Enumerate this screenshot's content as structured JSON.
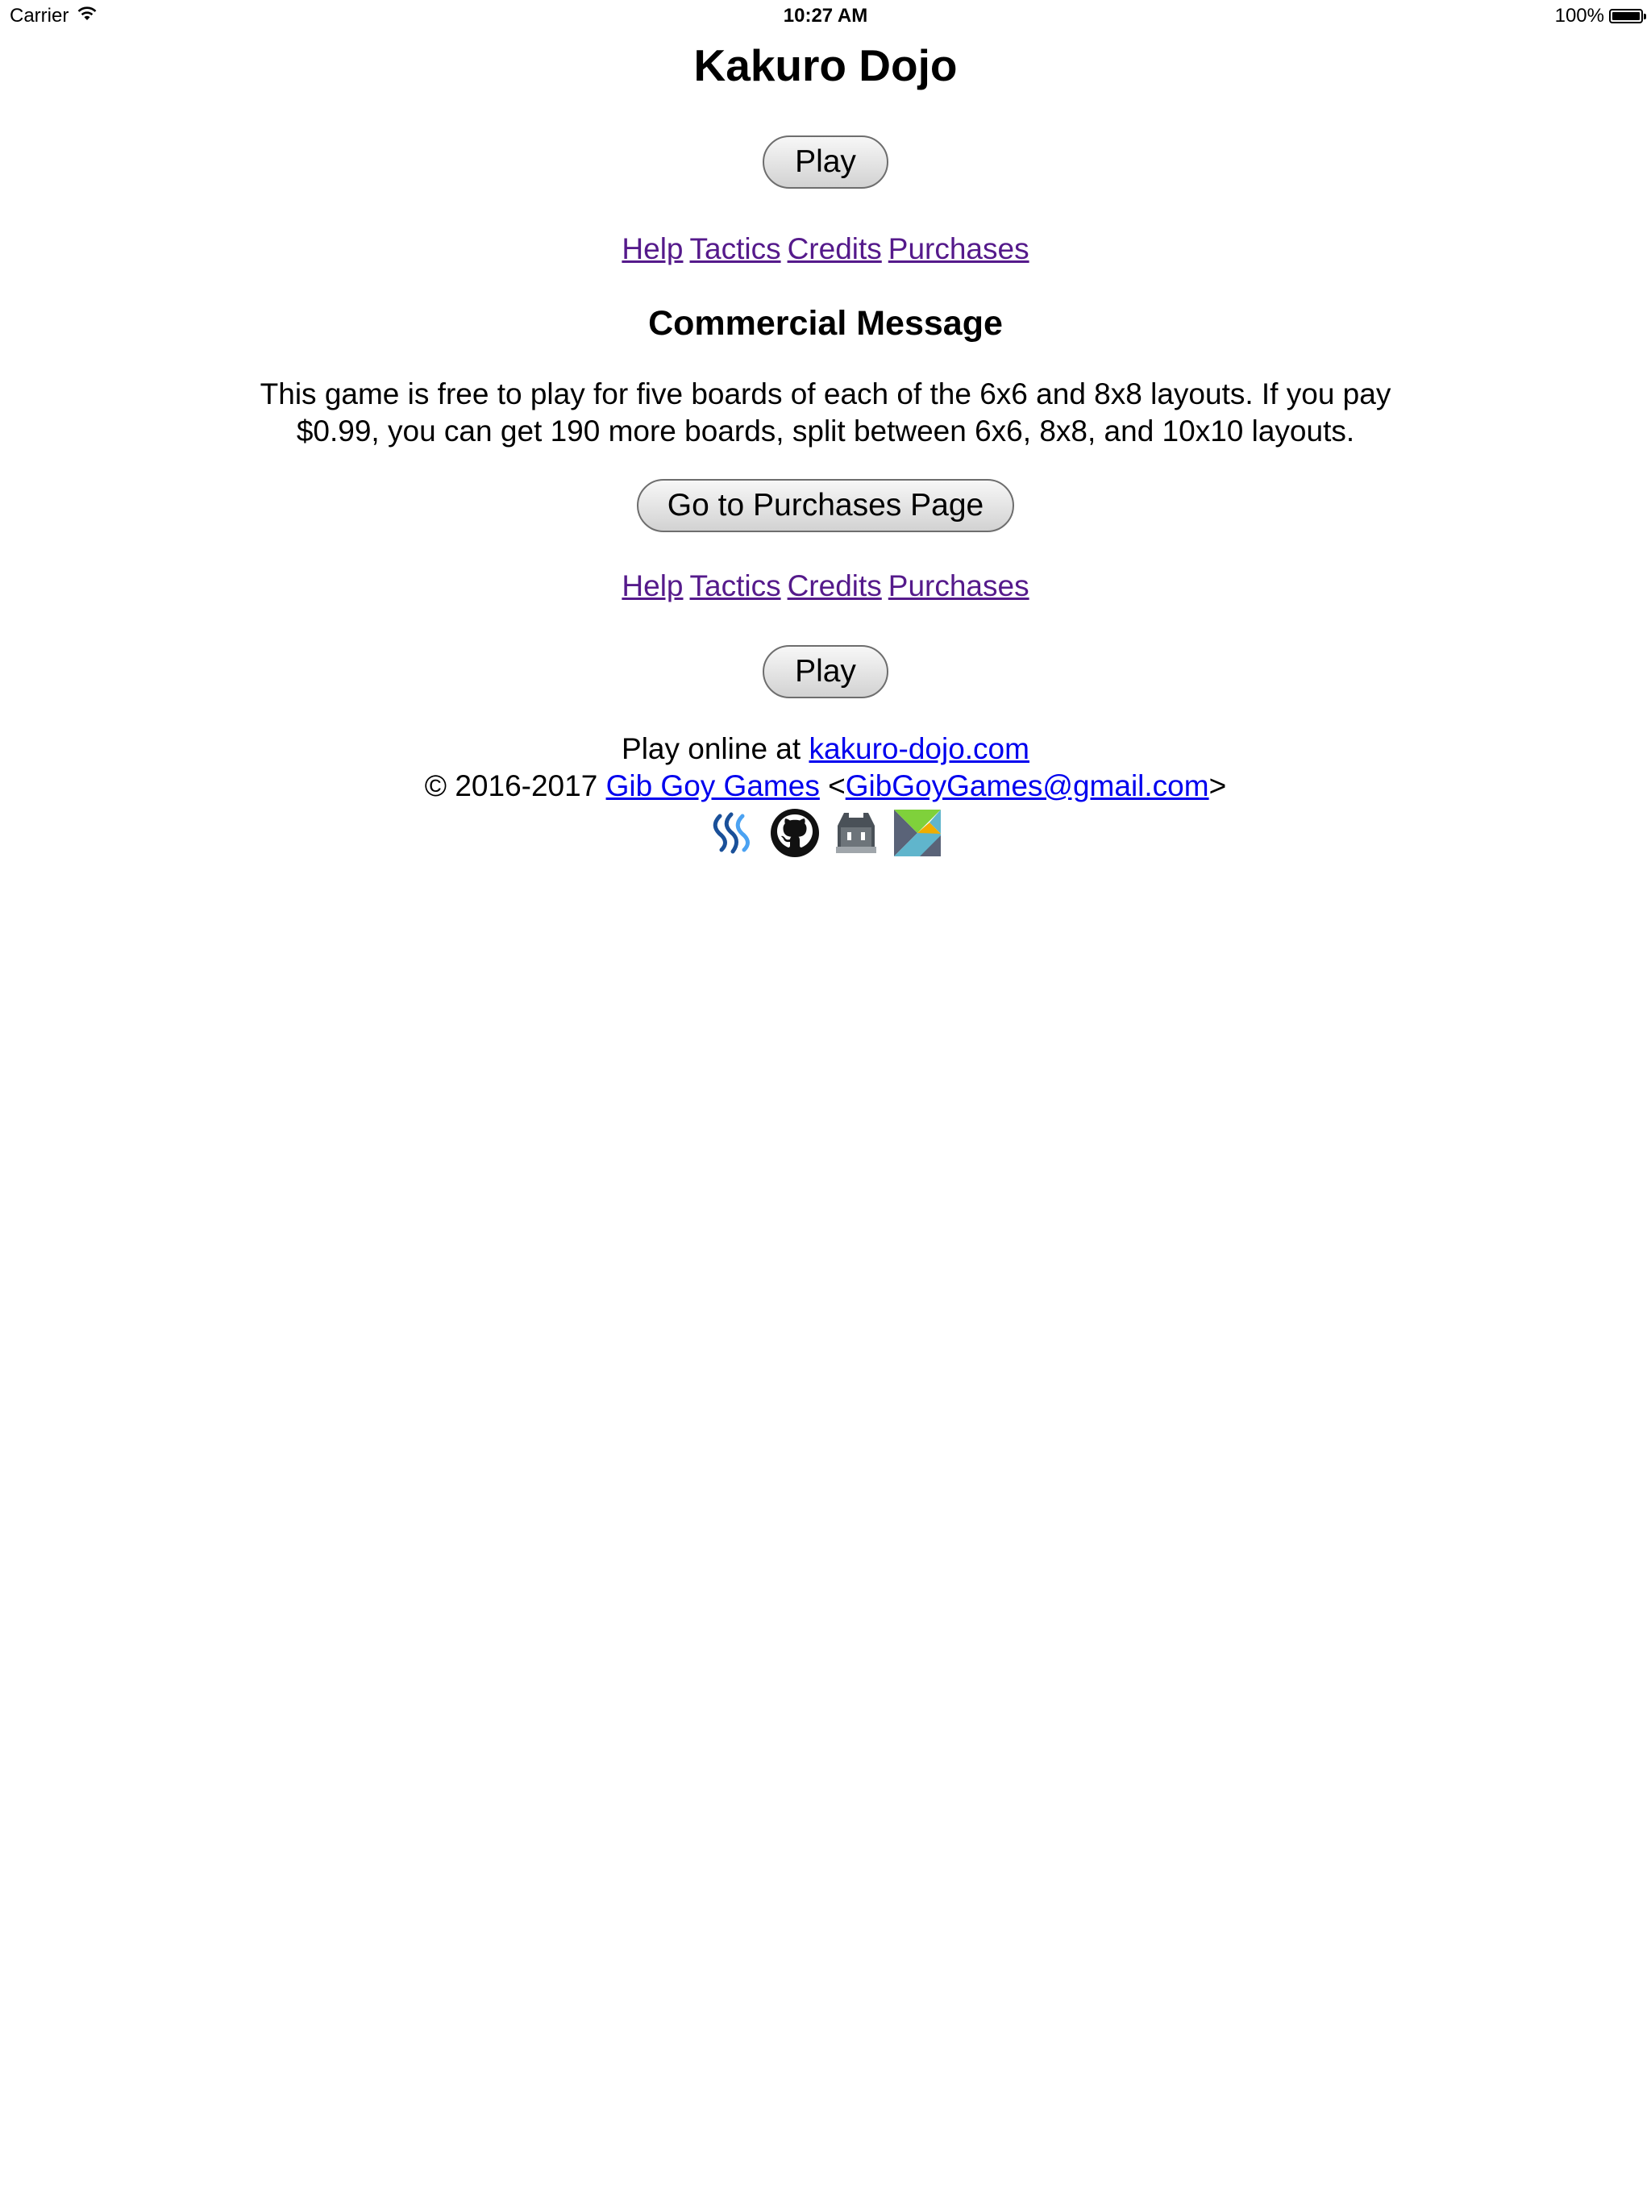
{
  "status_bar": {
    "carrier": "Carrier",
    "time": "10:27 AM",
    "battery_percent": "100%",
    "battery_level": 1.0,
    "wifi_icon": "wifi-icon",
    "battery_icon": "battery-icon"
  },
  "page": {
    "title": "Kakuro Dojo",
    "play_label": "Play",
    "nav_links": {
      "help": "Help",
      "tactics": "Tactics",
      "credits": "Credits",
      "purchases": "Purchases"
    },
    "commercial_heading": "Commercial Message",
    "commercial_text": "This game is free to play for five boards of each of the 6x6 and 8x8 layouts. If you pay $0.99, you can get 190 more boards, split between 6x6, 8x8, and 10x10 layouts.",
    "purchase_button_label": "Go to Purchases Page"
  },
  "footer": {
    "play_online_prefix": "Play online at ",
    "site_link": "kakuro-dojo.com",
    "copyright_prefix": "© 2016-2017 ",
    "company_link": "Gib Goy Games",
    "email_open": " <",
    "email_link": "GibGoyGames@gmail.com",
    "email_close": ">",
    "icons": [
      "steemit-icon",
      "github-icon",
      "cordova-icon",
      "elm-icon"
    ]
  },
  "colors": {
    "visited_link": "#551a8b",
    "link": "#0000ee",
    "background": "#ffffff"
  }
}
